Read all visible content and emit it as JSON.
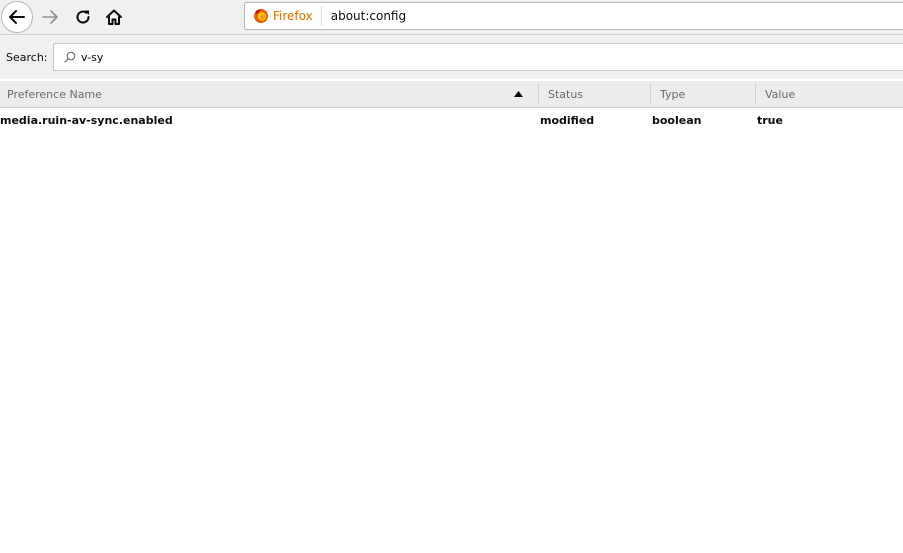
{
  "toolbar": {
    "identity_label": "Firefox",
    "url": "about:config"
  },
  "search": {
    "label": "Search:",
    "value": "v-sy"
  },
  "table": {
    "columns": [
      "Preference Name",
      "Status",
      "Type",
      "Value"
    ],
    "sorted_column": "Preference Name",
    "sort_direction": "ascending",
    "rows": [
      {
        "name": "media.ruin-av-sync.enabled",
        "status": "modified",
        "type": "boolean",
        "value": "true"
      }
    ]
  },
  "icons": {
    "back": "back-arrow-icon",
    "forward": "forward-arrow-icon",
    "reload": "reload-icon",
    "home": "home-icon",
    "identity": "firefox-logo-icon",
    "search": "magnifier-icon",
    "sort": "sort-ascending-icon"
  },
  "colors": {
    "identity_text": "#d76e00",
    "toolbar_bg": "#f0f0f0",
    "header_bg": "#ececec"
  }
}
